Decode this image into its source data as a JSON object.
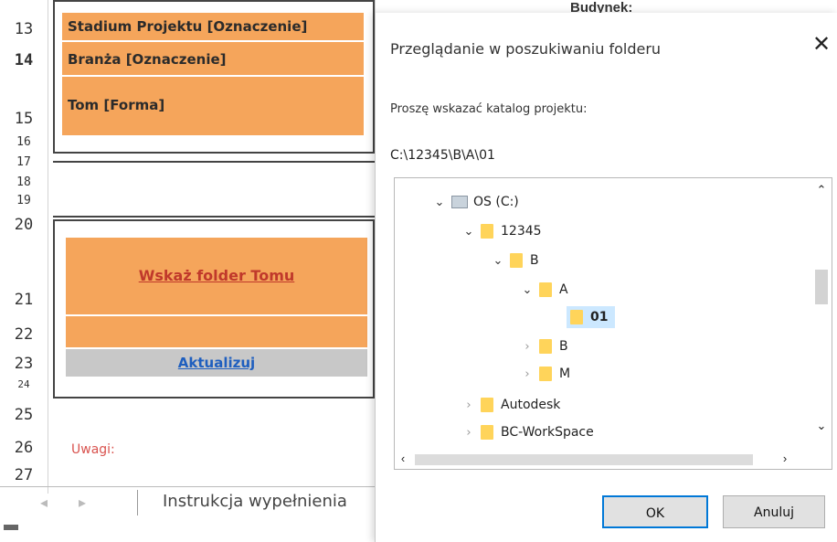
{
  "excel": {
    "row_numbers": [
      "13",
      "14",
      "15",
      "16",
      "17",
      "18",
      "19",
      "20",
      "21",
      "22",
      "23",
      "24",
      "25",
      "26",
      "27"
    ],
    "stadium_label": "Stadium Projektu [Oznaczenie]",
    "branza_label": "Branża [Oznaczenie]",
    "tom_label": "Tom [Forma]",
    "folder_link": "Wskaż folder Tomu",
    "update_link": "Aktualizuj",
    "notes_label": "Uwagi:",
    "sheet_tab": "Instrukcja wypełnienia",
    "top_right_fragment": "Budynek:",
    "colors": {
      "orange": "#f5a55b",
      "link_red": "#c0392b",
      "link_blue": "#1f5fbf"
    }
  },
  "dialog": {
    "title": "Przeglądanie w poszukiwaniu folderu",
    "close_icon": "close-icon",
    "prompt": "Proszę wskazać katalog projektu:",
    "current_path": "C:\\12345\\B\\A\\01",
    "tree": [
      {
        "label": "OS (C:)",
        "type": "drive",
        "expanded": true
      },
      {
        "label": "12345",
        "type": "folder",
        "expanded": true
      },
      {
        "label": "B",
        "type": "folder",
        "expanded": true
      },
      {
        "label": "A",
        "type": "folder",
        "expanded": true
      },
      {
        "label": "01",
        "type": "folder",
        "selected": true
      },
      {
        "label": "B",
        "type": "folder",
        "expanded": false
      },
      {
        "label": "M",
        "type": "folder",
        "expanded": false
      },
      {
        "label": "Autodesk",
        "type": "folder",
        "expanded": false
      },
      {
        "label": "BC-WorkSpace",
        "type": "folder",
        "expanded": false
      }
    ],
    "ok_label": "OK",
    "cancel_label": "Anuluj"
  }
}
